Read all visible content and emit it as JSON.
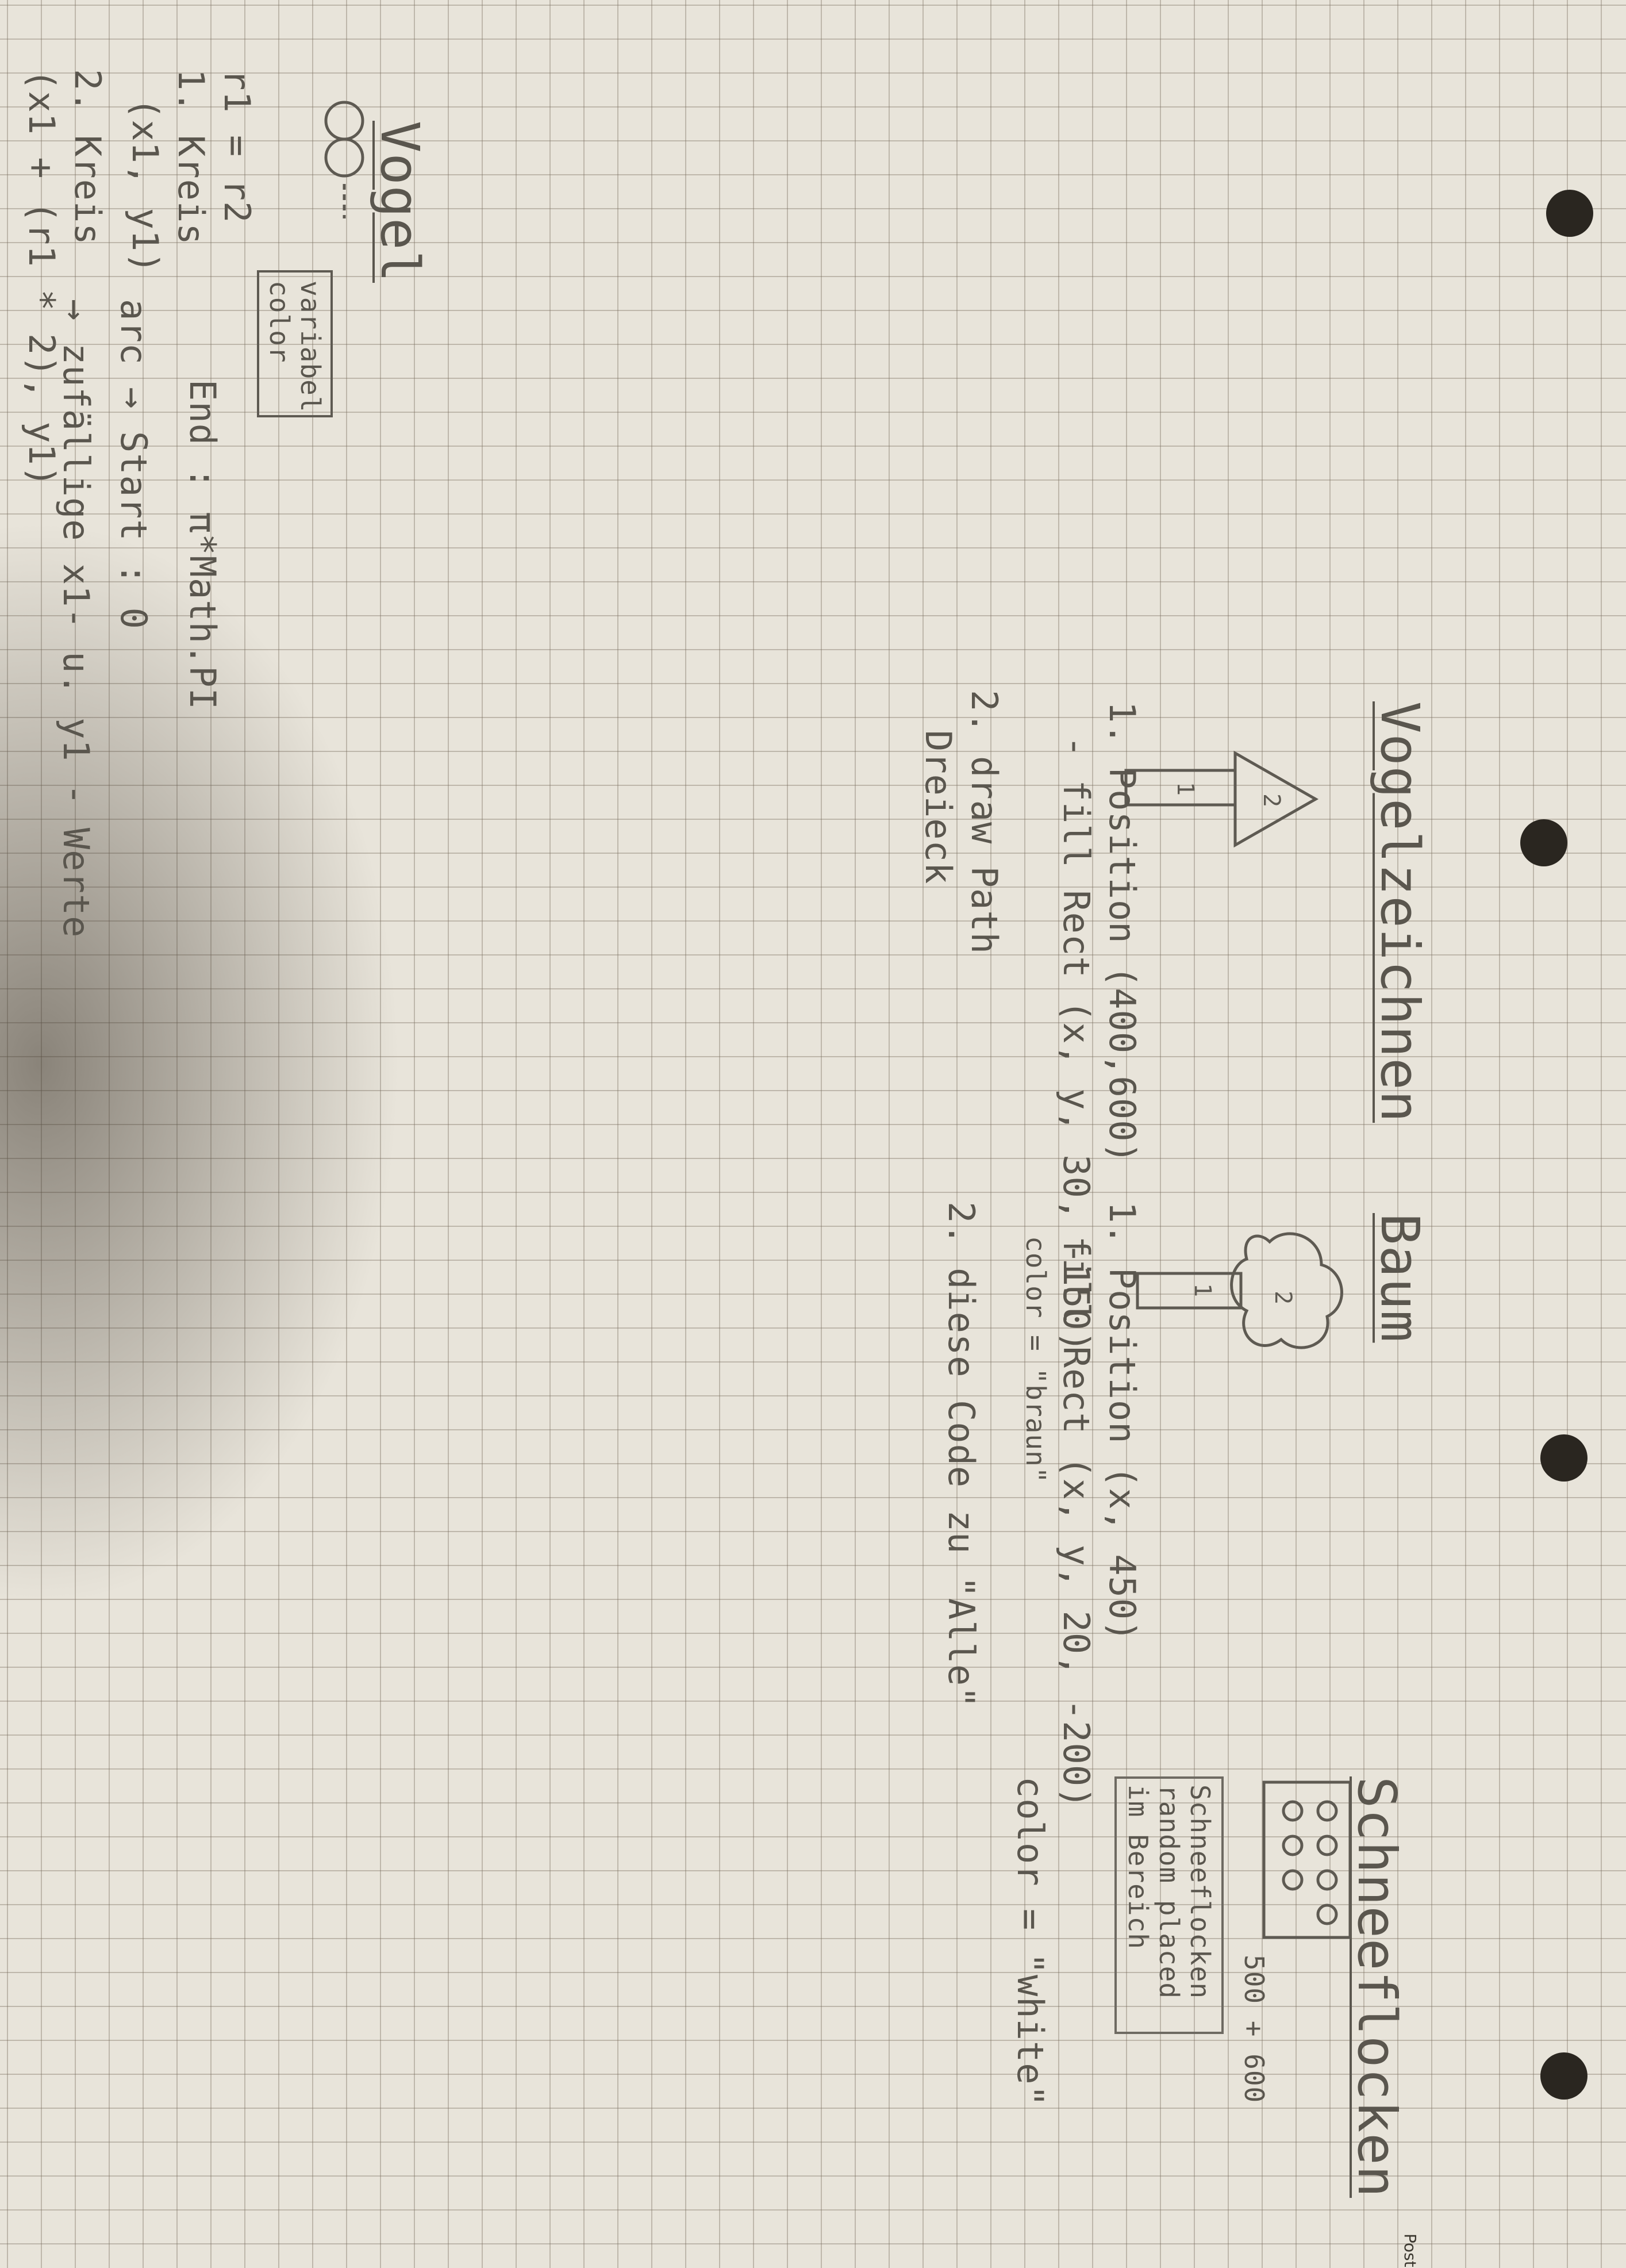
{
  "vogel": {
    "title": "Vogel",
    "var_box": "variabel color",
    "radius": "r1 = r2",
    "kreis1": "1. Kreis",
    "kreis1_coords": "(x1, y1)",
    "kreis2": "2. Kreis",
    "kreis2_coords": "(x1 + (r1 * 2), y1)",
    "arc_start": "arc → Start : 0",
    "arc_end": "End : π*Math.PI",
    "random": "→ zufällige x1- u. y1 - Werte"
  },
  "vogelzeichnen": {
    "title": "Vogelzeichnen",
    "step1": "1. Position (400,600)",
    "step1_detail": "- fill Rect (x, y, 30, -150)",
    "step2": "2. draw Path",
    "step2_detail": "Dreieck",
    "labels": [
      "1",
      "2"
    ]
  },
  "baum": {
    "title": "Baum",
    "step1": "1. Position (x, 450)",
    "step1_detail": "fill Rect (x, y, 20, -200)",
    "color": "color = \"braun\"",
    "step2": "2. diese Code zu \"Alle\"",
    "labels": [
      "1",
      "2"
    ]
  },
  "schneeflocken": {
    "title": "Schneeflocken",
    "box_text": "Schneeflocken random placed im Bereich",
    "color": "color = \"white\"",
    "note": "500 + 600"
  },
  "footer": {
    "brand": "Post"
  },
  "colors": {
    "paper": "#e8e4da",
    "grid": "#8a8070",
    "pencil": "#5a564e",
    "hole": "#2a2620"
  }
}
